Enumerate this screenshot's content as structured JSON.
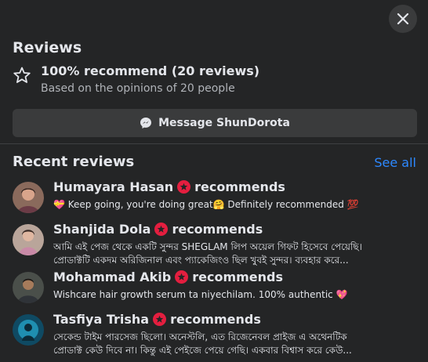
{
  "header": {
    "title": "Reviews",
    "recommend_text": "100% recommend (20 reviews)",
    "based_on": "Based on the opinions of 20 people",
    "message_button": "Message ShunDorota"
  },
  "recent": {
    "title": "Recent reviews",
    "see_all": "See all",
    "recommends_label": "recommends",
    "items": [
      {
        "name": "Humayara Hasan",
        "line1": "💝 Keep going, you're doing great🤗 Definitely recommended 💯",
        "line2": ""
      },
      {
        "name": "Shanjida Dola",
        "line1": "আমি এই পেজ থেকে একটি সুন্দর SHEGLAM লিপ অয়েল গিফট হিসেবে পেয়েছি।",
        "line2": "প্রোডাক্টটি একদম অরিজিনাল এবং প্যাকেজিংও ছিল খুবই সুন্দর। ব্যবহার করে..."
      },
      {
        "name": "Mohammad Akib",
        "line1": "Wishcare hair growth serum ta niyechilam. 100% authentic 💖",
        "line2": ""
      },
      {
        "name": "Tasfiya Trisha",
        "line1": "সেকেন্ড টাইম পারসেজ ছিলো। অনেস্টলি, এত রিজেনেবল প্রাইজ এ অথেনটিক",
        "line2": "প্রোডাক্ট কেউ দিবে না। কিন্তু এই পেইজে পেয়ে গেছি। একবার বিশ্বাস করে কেউ..."
      }
    ]
  },
  "colors": {
    "background": "#242526",
    "button": "#3a3b3c",
    "link": "#2d88ff",
    "badge": "#e41e3f"
  }
}
